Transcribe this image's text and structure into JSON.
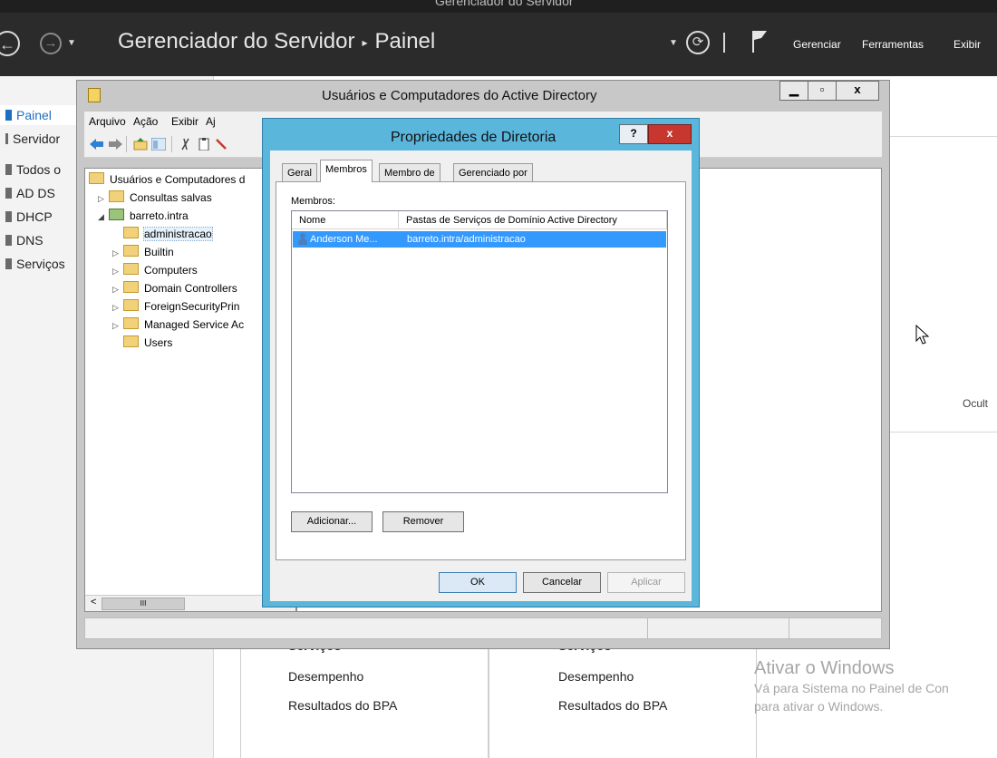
{
  "server_manager": {
    "window_title": "Gerenciador do Servidor",
    "breadcrumb": {
      "app": "Gerenciador do Servidor",
      "page": "Painel"
    },
    "menu": {
      "manage": "Gerenciar",
      "tools": "Ferramentas",
      "view": "Exibir"
    },
    "sidebar": [
      {
        "label": "Painel",
        "active": true
      },
      {
        "label": "Servidor"
      },
      {
        "label": "Todos o"
      },
      {
        "label": "AD DS"
      },
      {
        "label": "DHCP"
      },
      {
        "label": "DNS"
      },
      {
        "label": "Serviços"
      }
    ],
    "hide_label": "Ocult",
    "tiles": [
      {
        "header": "Serviços",
        "items": [
          "Desempenho",
          "Resultados do BPA"
        ]
      },
      {
        "header": "Serviços",
        "items": [
          "Desempenho",
          "Resultados do BPA"
        ]
      }
    ]
  },
  "mmc": {
    "title": "Usuários e Computadores do Active Directory",
    "controls": {
      "minimize": "▁",
      "maximize": "▫",
      "close": "x"
    },
    "menu": [
      "Arquivo",
      "Ação",
      "Exibir",
      "Aj"
    ],
    "tree": [
      {
        "label": "Usuários e Computadores d",
        "level": 0,
        "arrow": ""
      },
      {
        "label": "Consultas salvas",
        "level": 1,
        "arrow": "▷"
      },
      {
        "label": "barreto.intra",
        "level": 1,
        "arrow": "◢"
      },
      {
        "label": "administracao",
        "level": 2,
        "arrow": "",
        "selected": true
      },
      {
        "label": "Builtin",
        "level": 2,
        "arrow": "▷"
      },
      {
        "label": "Computers",
        "level": 2,
        "arrow": "▷"
      },
      {
        "label": "Domain Controllers",
        "level": 2,
        "arrow": "▷"
      },
      {
        "label": "ForeignSecurityPrin",
        "level": 2,
        "arrow": "▷"
      },
      {
        "label": "Managed Service Ac",
        "level": 2,
        "arrow": "▷"
      },
      {
        "label": "Users",
        "level": 2,
        "arrow": ""
      }
    ],
    "scroll_grip": "III",
    "scroll_left": "<"
  },
  "dialog": {
    "title": "Propriedades de Diretoria",
    "help": "?",
    "close": "x",
    "tabs": [
      "Geral",
      "Membros",
      "Membro de",
      "Gerenciado por"
    ],
    "active_tab": "Membros",
    "members_label": "Membros:",
    "columns": [
      "Nome",
      "Pastas de Serviços de Domínio Active Directory"
    ],
    "rows": [
      {
        "name": "Anderson Me...",
        "folder": "barreto.intra/administracao"
      }
    ],
    "add_button": "Adicionar...",
    "remove_button": "Remover",
    "ok_button": "OK",
    "cancel_button": "Cancelar",
    "apply_button": "Aplicar"
  },
  "activation": {
    "heading": "Ativar o Windows",
    "line1": "Vá para Sistema no Painel de Con",
    "line2": "para ativar o Windows."
  }
}
